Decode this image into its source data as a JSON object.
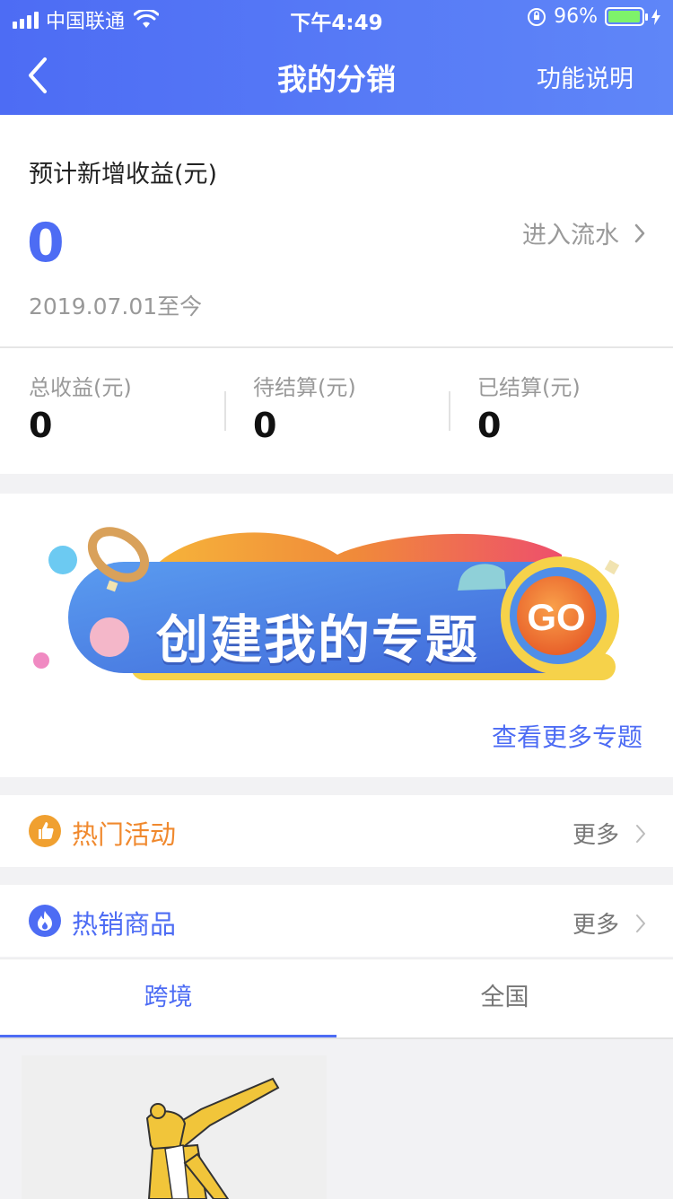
{
  "status_bar": {
    "carrier": "中国联通",
    "time": "下午4:49",
    "battery_percent": "96%",
    "battery_level": 0.96
  },
  "nav": {
    "title": "我的分销",
    "help_label": "功能说明"
  },
  "earnings": {
    "label": "预计新增收益(元)",
    "value": "0",
    "since": "2019.07.01至今",
    "flow_label": "进入流水"
  },
  "stats": [
    {
      "label": "总收益(元)",
      "value": "0"
    },
    {
      "label": "待结算(元)",
      "value": "0"
    },
    {
      "label": "已结算(元)",
      "value": "0"
    }
  ],
  "banner": {
    "text": "创建我的专题",
    "go_label": "GO",
    "more_label": "查看更多专题"
  },
  "sections": {
    "hot_activities": {
      "label": "热门活动",
      "more": "更多",
      "color": "#f0892e"
    },
    "hot_products": {
      "label": "热销商品",
      "more": "更多",
      "color": "#4d6cf4"
    }
  },
  "tabs": [
    {
      "label": "跨境",
      "active": true
    },
    {
      "label": "全国",
      "active": false
    }
  ],
  "colors": {
    "accent": "#4d6cf4",
    "orange": "#f0892e"
  }
}
